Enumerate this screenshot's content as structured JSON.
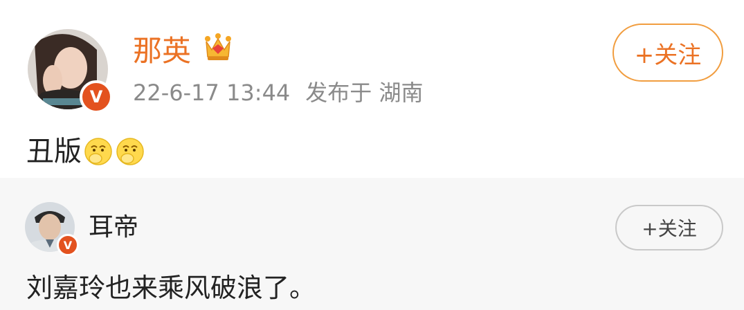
{
  "post": {
    "author": "那英",
    "badge_letter": "V",
    "timestamp": "22-6-17 13:44",
    "location_label": "发布于 湖南",
    "follow_label": "+关注",
    "content_text": "丑版",
    "content_emojis": [
      "pondering-face-icon",
      "pondering-face-icon"
    ]
  },
  "repost": {
    "author": "耳帝",
    "badge_letter": "V",
    "follow_label": "+关注",
    "content_text": "刘嘉玲也来乘风破浪了。"
  },
  "colors": {
    "name_orange": "#eb7224",
    "follow_border_orange": "#f19d3f",
    "verified_red": "#e3521f",
    "meta_gray": "#8a8a8a",
    "repost_bg": "#f7f7f7"
  }
}
